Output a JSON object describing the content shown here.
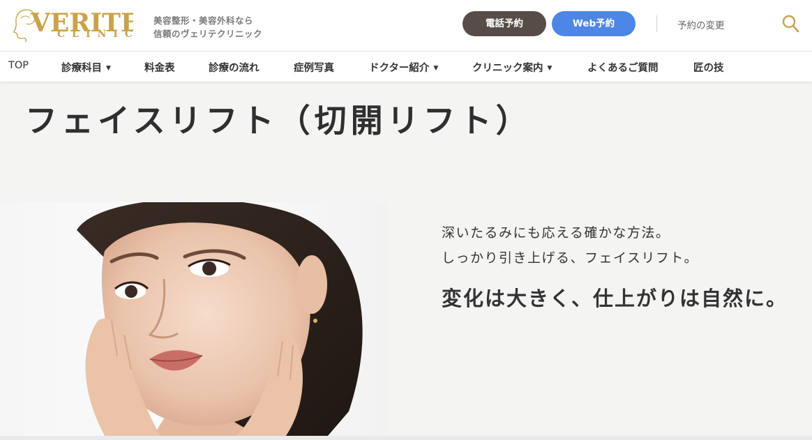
{
  "header": {
    "logo": {
      "main": "VERITE",
      "sub": "CLINIC",
      "icon": "woman-profile-logo-icon"
    },
    "tagline": [
      "美容整形・美容外科なら",
      "信頼のヴェリテクリニック"
    ],
    "tel_button": "電話予約",
    "web_button": "Web予約",
    "change_link": "予約の変更",
    "search_icon": "search-icon"
  },
  "nav": {
    "items": [
      {
        "label": "TOP",
        "dropdown": false
      },
      {
        "label": "診療科目",
        "dropdown": true
      },
      {
        "label": "料金表",
        "dropdown": false
      },
      {
        "label": "診療の流れ",
        "dropdown": false
      },
      {
        "label": "症例写真",
        "dropdown": false
      },
      {
        "label": "ドクター紹介",
        "dropdown": true
      },
      {
        "label": "クリニック案内",
        "dropdown": true
      },
      {
        "label": "よくあるご質問",
        "dropdown": false
      },
      {
        "label": "匠の技",
        "dropdown": false
      }
    ],
    "caret": "▼"
  },
  "main": {
    "title": "フェイスリフト（切開リフト）",
    "lead_lines": [
      "深いたるみにも応える確かな方法。",
      "しっかり引き上げる、フェイスリフト。"
    ],
    "headline": "変化は大きく、仕上がりは自然に。"
  },
  "colors": {
    "gold": "#c9a24a",
    "tel_button": "#574c48",
    "web_button": "#4d86e4",
    "background": "#f4f4f2"
  }
}
